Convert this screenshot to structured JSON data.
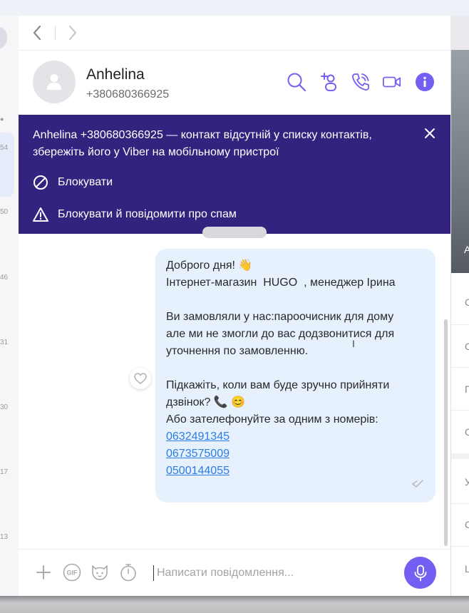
{
  "nav": {
    "back_label": "Back",
    "forward_label": "Forward"
  },
  "left_list": {
    "times": [
      "54",
      "50",
      "46",
      "31",
      "30",
      "17",
      "13"
    ]
  },
  "contact": {
    "name": "Anhelina",
    "phone": "+380680366925"
  },
  "header_icons": [
    "search-icon",
    "add-participant-icon",
    "call-icon",
    "video-call-icon",
    "info-icon"
  ],
  "colors": {
    "banner_bg": "#33237e",
    "accent": "#7360f2",
    "bubble_bg": "#e7f0fd",
    "link": "#2b7de0"
  },
  "banner": {
    "text": "Anhelina +380680366925 — контакт відсутній у списку контактів, збережіть його у Viber на мобільному пристрої",
    "block_label": "Блокувати",
    "block_report_label": "Блокувати й повідомити про спам"
  },
  "message": {
    "lines": [
      "Доброго дня! 👋",
      "Інтернет-магазин  HUGO  , менеджер Ірина",
      "",
      "Ви замовляли у нас:пароочисник для дому",
      "але ми не змогли до вас додзвонитися для",
      "уточнення по замовленню.",
      "",
      "Підкажіть, коли вам буде зручно прийняти",
      "дзвінок? 📞 😊",
      "Або зателефонуйте за одним з номерів:"
    ],
    "phones": [
      "0632491345",
      "0673575009",
      "0500144055"
    ]
  },
  "composer": {
    "placeholder": "Написати повідомлення..."
  },
  "right_panel": {
    "image_letter": "A",
    "items": [
      "C",
      "C",
      "Г",
      "C",
      "У",
      "C",
      "L"
    ]
  }
}
